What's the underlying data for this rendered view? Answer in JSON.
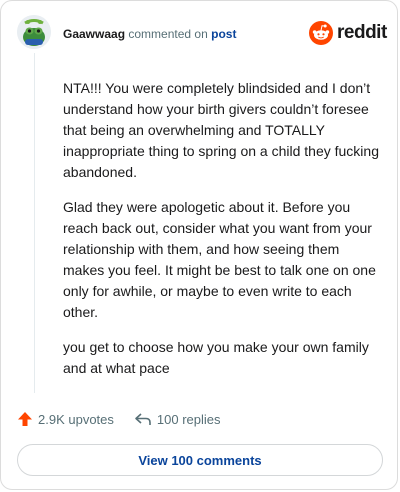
{
  "header": {
    "username": "Gaawwaag",
    "action_text": "commented on",
    "post_link": "post",
    "avatar_icon": "frog-avatar-icon"
  },
  "brand": {
    "logo_text": "reddit",
    "logo_icon": "reddit-snoo-icon",
    "logo_color": "#ff4500"
  },
  "comment": {
    "paragraphs": [
      "NTA!!! You were completely blindsided and I don’t understand how your birth givers couldn’t foresee that being an overwhelming and TOTALLY inappropriate thing to spring on a child they fucking abandoned.",
      "Glad they were apologetic about it. Before you reach back out, consider what you want from your relationship with them, and how seeing them makes you feel. It might be best to talk one on one only for awhile, or maybe to even write to each other.",
      "you get to choose how you make your own family and at what pace"
    ]
  },
  "actions": {
    "upvotes_label": "2.9K upvotes",
    "upvote_icon": "upvote-arrow-icon",
    "upvote_color": "#ff4500",
    "replies_label": "100 replies",
    "reply_icon": "reply-arrow-icon"
  },
  "footer": {
    "view_comments_label": "View 100 comments"
  },
  "colors": {
    "link": "#0a449b",
    "muted": "#576f76",
    "border": "#dcdcdc"
  }
}
